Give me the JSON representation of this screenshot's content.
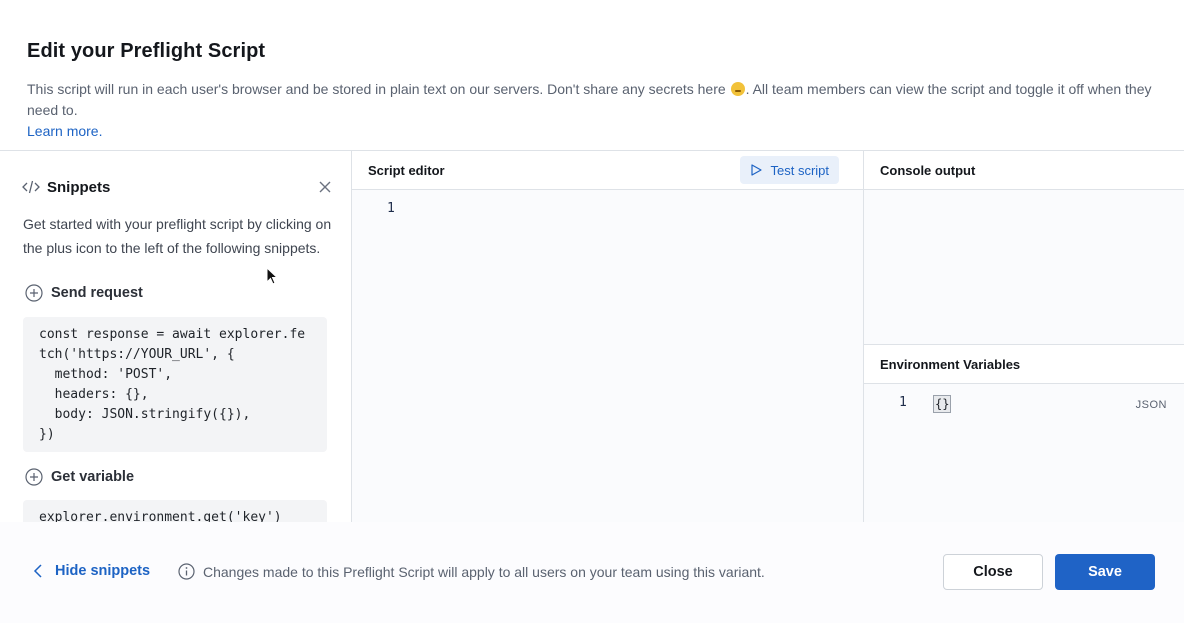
{
  "header": {
    "title": "Edit your Preflight Script",
    "description_before_emoji": "This script will run in each user's browser and be stored in plain text on our servers. Don't share any secrets here",
    "description_after_emoji": ". All team members can view the script and toggle it off when they need to.",
    "learn_more": "Learn more."
  },
  "snippets": {
    "title": "Snippets",
    "intro": "Get started with your preflight script by clicking on the plus icon to the left of the following snippets.",
    "items": [
      {
        "label": "Send request",
        "code": "const response = await explorer.fe\ntch('https://YOUR_URL', {\n  method: 'POST',\n  headers: {},\n  body: JSON.stringify({}),\n})"
      },
      {
        "label": "Get variable",
        "code": "explorer.environment.get('key')"
      }
    ]
  },
  "editor": {
    "title": "Script editor",
    "test_button": "Test script",
    "line_number": "1"
  },
  "console": {
    "title": "Console output",
    "env_title": "Environment Variables",
    "env_line_number": "1",
    "env_value": "{}",
    "env_format": "JSON"
  },
  "footer": {
    "hide_snippets": "Hide snippets",
    "info": "Changes made to this Preflight Script will apply to all users on your team using this variant.",
    "close": "Close",
    "save": "Save"
  },
  "colors": {
    "accent": "#1f63c6",
    "link": "#1d63c4",
    "border": "#dee2e7"
  }
}
